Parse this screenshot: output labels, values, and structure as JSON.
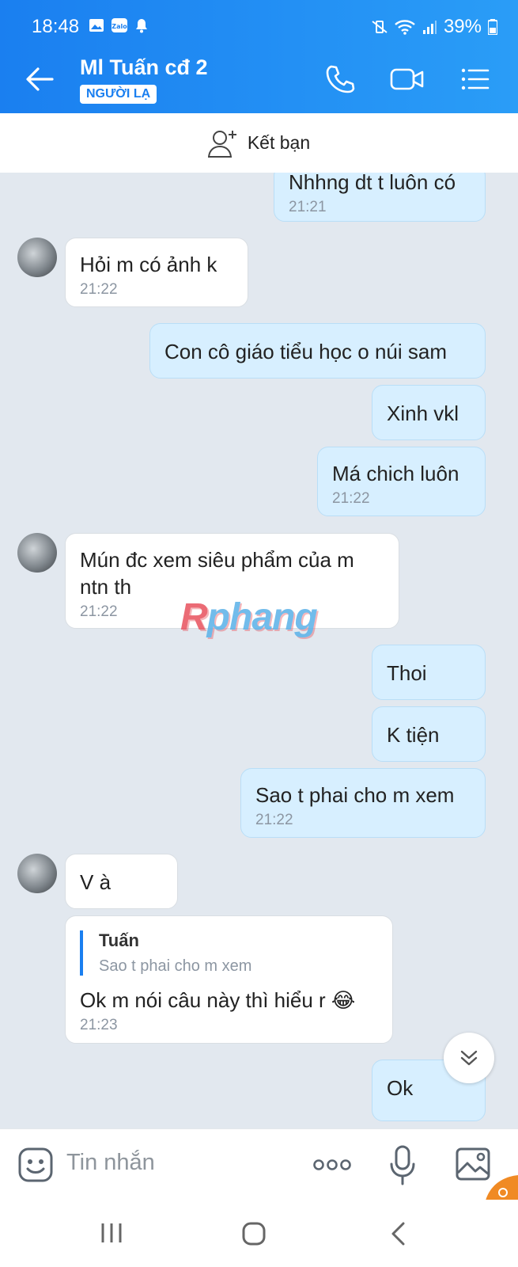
{
  "status": {
    "time": "18:48",
    "battery": "39%"
  },
  "header": {
    "title": "Ml Tuấn cđ 2",
    "badge": "NGƯỜI LẠ"
  },
  "friend_bar": {
    "label": "Kết bạn"
  },
  "messages": [
    {
      "dir": "out",
      "text": "Nhhng dt t luôn có",
      "time": "21:21"
    },
    {
      "dir": "in",
      "text": "Hỏi m có ảnh k",
      "time": "21:22"
    },
    {
      "dir": "out",
      "text": "Con cô giáo tiểu học o núi sam",
      "time": ""
    },
    {
      "dir": "out",
      "text": "Xinh vkl",
      "time": ""
    },
    {
      "dir": "out",
      "text": "Má chich luôn",
      "time": "21:22"
    },
    {
      "dir": "in",
      "text_line1": "Mún đc xem siêu phẩm của m",
      "text_line2": "ntn th",
      "time": "21:22"
    },
    {
      "dir": "out",
      "text": "Thoi",
      "time": ""
    },
    {
      "dir": "out",
      "text": "K tiện",
      "time": ""
    },
    {
      "dir": "out",
      "text": "Sao t phai cho m xem",
      "time": "21:22"
    },
    {
      "dir": "in",
      "text": "V à",
      "time": ""
    },
    {
      "dir": "in",
      "reply_name": "Tuấn",
      "reply_text": "Sao t phai cho m xem",
      "text": "Ok m nói câu này thì hiểu r 😂",
      "time": "21:23"
    },
    {
      "dir": "out",
      "text": "Ok",
      "time": ""
    }
  ],
  "watermark": {
    "r": "R",
    "rest": "phang"
  },
  "input": {
    "placeholder": "Tin nhắn"
  },
  "icons": {
    "back": "arrow-left-icon",
    "call": "phone-icon",
    "video": "video-camera-icon",
    "menu": "list-menu-icon",
    "add_friend": "add-person-icon",
    "sticker": "sticker-face-icon",
    "more": "more-dots-icon",
    "mic": "microphone-icon",
    "image": "image-icon",
    "scroll_down": "double-chevron-down-icon"
  },
  "colors": {
    "header": "#1a7ff0",
    "outgoing_bubble": "#d7efff",
    "incoming_bubble": "#ffffff",
    "background": "#e2e8ef"
  }
}
